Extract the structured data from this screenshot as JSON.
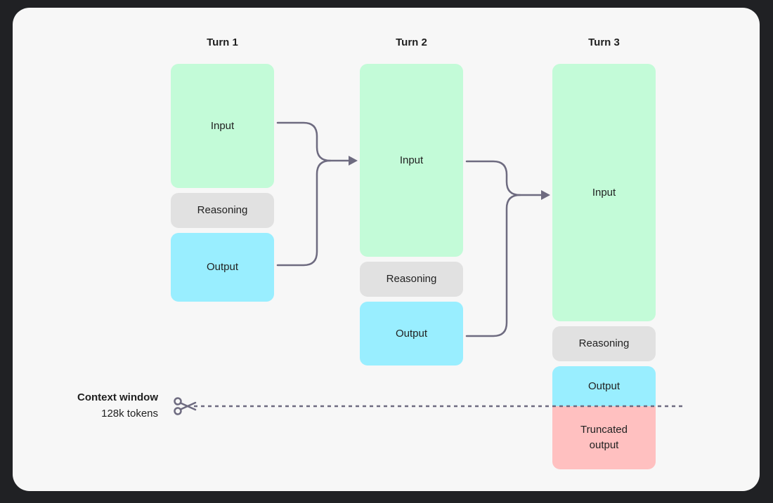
{
  "diagram": {
    "colors": {
      "input": "#c3fbd8",
      "reasoning": "#e1e1e1",
      "output": "#99eeff",
      "truncated": "#ffc0c0",
      "connector": "#6e6b80"
    },
    "turns": [
      {
        "title": "Turn 1",
        "blocks": {
          "input": "Input",
          "reasoning": "Reasoning",
          "output": "Output"
        }
      },
      {
        "title": "Turn 2",
        "blocks": {
          "input": "Input",
          "reasoning": "Reasoning",
          "output": "Output"
        }
      },
      {
        "title": "Turn 3",
        "blocks": {
          "input": "Input",
          "reasoning": "Reasoning",
          "output": "Output",
          "truncated": "Truncated output"
        }
      }
    ],
    "context_window": {
      "title": "Context window",
      "size": "128k tokens",
      "icon": "scissors-icon"
    },
    "connectors": [
      {
        "from": [
          "Turn 1 Input",
          "Turn 1 Output"
        ],
        "to": "Turn 2 Input"
      },
      {
        "from": [
          "Turn 2 Input",
          "Turn 2 Output"
        ],
        "to": "Turn 3 Input"
      }
    ]
  }
}
